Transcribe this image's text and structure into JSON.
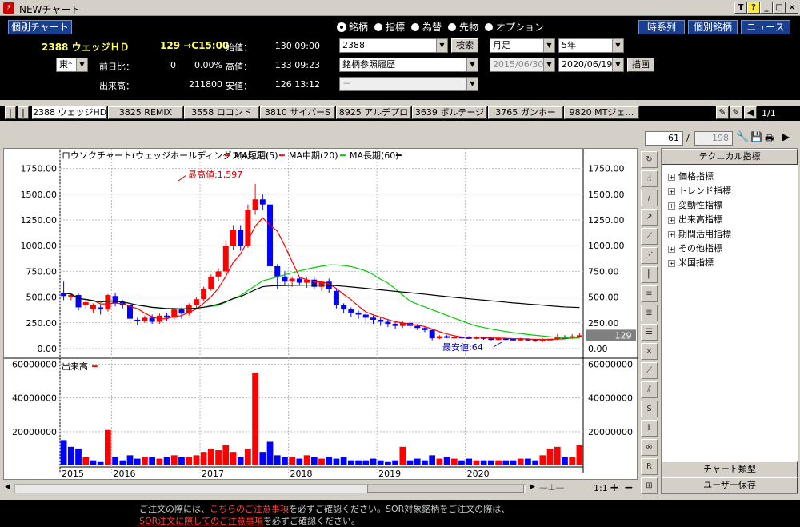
{
  "window": {
    "title": "NEWチャート",
    "controls": [
      "T",
      "?",
      "_",
      "□",
      "×"
    ]
  },
  "top": {
    "stock_list_btn": "個別チャート",
    "stock_code_name": "2388 ウェッジＨＤ",
    "price_line": "129 →C15:00",
    "exchange": "東*",
    "labels": {
      "open": "始値：",
      "high": "高値：",
      "low": "安値：",
      "change": "前日比：",
      "volume": "出来高："
    },
    "values": {
      "open": "130 09:00",
      "high": "133 09:23",
      "low": "126 13:12",
      "change": "0",
      "change_pct": "0.00%",
      "volume": "211800"
    },
    "radios": [
      {
        "label": "銘柄",
        "selected": true
      },
      {
        "label": "指標",
        "selected": false
      },
      {
        "label": "為替",
        "selected": false
      },
      {
        "label": "先物",
        "selected": false
      },
      {
        "label": "オプション",
        "selected": false
      }
    ],
    "code_input": "2388",
    "search_btn": "検索",
    "history_select": "銘柄参照履歴",
    "empty_select": "－",
    "period_select": "月足",
    "range_select": "5年",
    "date_from": "2015/06/30",
    "date_to": "2020/06/19",
    "draw_btn": "描画",
    "buttons_right": [
      "時系列",
      "個別銘柄",
      "ニュース"
    ]
  },
  "stock_tabs": [
    "2388 ウェッジHD",
    "3825 REMIX",
    "3558 ロコンド",
    "3810 サイバーS",
    "8925 アルデプロ",
    "3639 ボルテージ",
    "3765 ガンホー",
    "9820 MTジェ…"
  ],
  "page_counter": "1/1",
  "nav": {
    "current": "61",
    "sep": "/",
    "total": "198"
  },
  "chart": {
    "legend": "ロウソクチャート(ウェッジホールディングス)(月足)",
    "ma": [
      "MA短期(5)",
      "MA中期(20)",
      "MA長期(60)"
    ],
    "high_label": "最高値:1,597",
    "low_label": "最安値:64",
    "current_price": "129",
    "volume_label": "出来高"
  },
  "chart_data": {
    "type": "candlestick",
    "y_ticks": [
      "1750.00",
      "1500.00",
      "1250.00",
      "1000.00",
      "750.00",
      "500.00",
      "250.00",
      "0.00"
    ],
    "vol_ticks": [
      "60000000",
      "40000000",
      "20000000"
    ],
    "x_labels": [
      "2015",
      "2016",
      "2017",
      "2018",
      "2019",
      "2020"
    ],
    "ylim": [
      0,
      1750
    ],
    "volume_ylim": [
      0,
      60000000
    ],
    "candles": [
      [
        510,
        540,
        510,
        650,
        470,
        "d"
      ],
      [
        500,
        520,
        480,
        530,
        470,
        "u"
      ],
      [
        520,
        400,
        380,
        540,
        370,
        "d"
      ],
      [
        420,
        450,
        400,
        470,
        390,
        "u"
      ],
      [
        380,
        420,
        360,
        440,
        350,
        "u"
      ],
      [
        400,
        380,
        340,
        420,
        330,
        "d"
      ],
      [
        380,
        520,
        370,
        530,
        360,
        "u"
      ],
      [
        510,
        440,
        430,
        540,
        410,
        "d"
      ],
      [
        450,
        420,
        400,
        470,
        390,
        "d"
      ],
      [
        420,
        290,
        280,
        430,
        270,
        "d"
      ],
      [
        280,
        270,
        250,
        300,
        230,
        "d"
      ],
      [
        270,
        300,
        260,
        320,
        250,
        "u"
      ],
      [
        300,
        260,
        250,
        330,
        240,
        "d"
      ],
      [
        260,
        320,
        250,
        340,
        240,
        "u"
      ],
      [
        320,
        300,
        280,
        350,
        270,
        "d"
      ],
      [
        300,
        380,
        290,
        390,
        280,
        "u"
      ],
      [
        380,
        340,
        300,
        400,
        290,
        "d"
      ],
      [
        340,
        420,
        330,
        440,
        320,
        "u"
      ],
      [
        420,
        480,
        410,
        500,
        390,
        "u"
      ],
      [
        480,
        580,
        470,
        600,
        460,
        "u"
      ],
      [
        580,
        700,
        570,
        720,
        560,
        "u"
      ],
      [
        700,
        750,
        680,
        780,
        660,
        "u"
      ],
      [
        750,
        1000,
        740,
        1050,
        730,
        "u"
      ],
      [
        1000,
        1150,
        980,
        1200,
        960,
        "u"
      ],
      [
        1150,
        1000,
        980,
        1200,
        950,
        "d"
      ],
      [
        1000,
        1350,
        990,
        1400,
        980,
        "u"
      ],
      [
        1350,
        1450,
        1320,
        1600,
        1300,
        "u"
      ],
      [
        1450,
        1400,
        1380,
        1500,
        1350,
        "d"
      ],
      [
        1400,
        800,
        780,
        1420,
        760,
        "d"
      ],
      [
        800,
        700,
        600,
        820,
        580,
        "d"
      ],
      [
        700,
        650,
        620,
        750,
        610,
        "d"
      ],
      [
        650,
        680,
        620,
        700,
        600,
        "u"
      ],
      [
        680,
        640,
        620,
        690,
        610,
        "d"
      ],
      [
        640,
        670,
        600,
        690,
        590,
        "u"
      ],
      [
        670,
        600,
        590,
        700,
        580,
        "d"
      ],
      [
        600,
        650,
        570,
        660,
        560,
        "u"
      ],
      [
        650,
        580,
        560,
        680,
        540,
        "d"
      ],
      [
        560,
        420,
        400,
        580,
        390,
        "d"
      ],
      [
        420,
        380,
        350,
        440,
        340,
        "d"
      ],
      [
        380,
        350,
        320,
        400,
        310,
        "d"
      ],
      [
        350,
        330,
        300,
        370,
        290,
        "d"
      ],
      [
        330,
        300,
        280,
        350,
        260,
        "d"
      ],
      [
        300,
        280,
        250,
        320,
        240,
        "d"
      ],
      [
        280,
        260,
        230,
        300,
        220,
        "d"
      ],
      [
        260,
        240,
        220,
        280,
        210,
        "d"
      ],
      [
        240,
        220,
        200,
        260,
        190,
        "d"
      ],
      [
        220,
        250,
        210,
        270,
        200,
        "u"
      ],
      [
        250,
        220,
        210,
        270,
        200,
        "d"
      ],
      [
        220,
        200,
        190,
        240,
        180,
        "d"
      ],
      [
        200,
        180,
        170,
        210,
        160,
        "d"
      ],
      [
        180,
        100,
        90,
        190,
        80,
        "d"
      ],
      [
        100,
        120,
        95,
        130,
        90,
        "u"
      ],
      [
        120,
        110,
        100,
        130,
        100,
        "d"
      ],
      [
        110,
        115,
        100,
        125,
        100,
        "u"
      ],
      [
        115,
        110,
        100,
        120,
        100,
        "d"
      ],
      [
        110,
        105,
        95,
        120,
        95,
        "d"
      ],
      [
        105,
        110,
        95,
        120,
        90,
        "u"
      ],
      [
        110,
        100,
        90,
        115,
        85,
        "d"
      ],
      [
        100,
        95,
        85,
        110,
        80,
        "d"
      ],
      [
        95,
        100,
        85,
        110,
        80,
        "u"
      ],
      [
        100,
        95,
        85,
        105,
        80,
        "d"
      ],
      [
        95,
        90,
        80,
        100,
        75,
        "d"
      ],
      [
        90,
        95,
        80,
        105,
        75,
        "u"
      ],
      [
        95,
        85,
        75,
        100,
        70,
        "d"
      ],
      [
        85,
        80,
        70,
        95,
        65,
        "d"
      ],
      [
        80,
        90,
        70,
        100,
        64,
        "u"
      ],
      [
        90,
        95,
        80,
        110,
        75,
        "u"
      ],
      [
        95,
        110,
        90,
        140,
        85,
        "u"
      ],
      [
        110,
        100,
        95,
        130,
        90,
        "d"
      ],
      [
        100,
        120,
        95,
        140,
        90,
        "u"
      ],
      [
        120,
        129,
        110,
        150,
        105,
        "u"
      ]
    ],
    "volume": [
      [
        15,
        "d"
      ],
      [
        11,
        "d"
      ],
      [
        10,
        "d"
      ],
      [
        5,
        "u"
      ],
      [
        3,
        "d"
      ],
      [
        2,
        "d"
      ],
      [
        21,
        "u"
      ],
      [
        5,
        "d"
      ],
      [
        3,
        "d"
      ],
      [
        6,
        "d"
      ],
      [
        4,
        "d"
      ],
      [
        5,
        "u"
      ],
      [
        5,
        "d"
      ],
      [
        4,
        "u"
      ],
      [
        5,
        "d"
      ],
      [
        6,
        "u"
      ],
      [
        5,
        "d"
      ],
      [
        5,
        "u"
      ],
      [
        6,
        "u"
      ],
      [
        8,
        "u"
      ],
      [
        10,
        "u"
      ],
      [
        9,
        "u"
      ],
      [
        12,
        "u"
      ],
      [
        8,
        "u"
      ],
      [
        5,
        "d"
      ],
      [
        10,
        "u"
      ],
      [
        55,
        "u"
      ],
      [
        8,
        "d"
      ],
      [
        14,
        "d"
      ],
      [
        6,
        "d"
      ],
      [
        5,
        "d"
      ],
      [
        5,
        "u"
      ],
      [
        4,
        "d"
      ],
      [
        6,
        "u"
      ],
      [
        5,
        "d"
      ],
      [
        4,
        "u"
      ],
      [
        5,
        "d"
      ],
      [
        4,
        "d"
      ],
      [
        5,
        "d"
      ],
      [
        3,
        "d"
      ],
      [
        3,
        "d"
      ],
      [
        3,
        "d"
      ],
      [
        4,
        "d"
      ],
      [
        3,
        "d"
      ],
      [
        2,
        "d"
      ],
      [
        3,
        "d"
      ],
      [
        11,
        "u"
      ],
      [
        3,
        "d"
      ],
      [
        4,
        "d"
      ],
      [
        3,
        "d"
      ],
      [
        6,
        "d"
      ],
      [
        4,
        "u"
      ],
      [
        5,
        "d"
      ],
      [
        4,
        "u"
      ],
      [
        3,
        "d"
      ],
      [
        4,
        "d"
      ],
      [
        3,
        "u"
      ],
      [
        3,
        "d"
      ],
      [
        3,
        "d"
      ],
      [
        3,
        "u"
      ],
      [
        3,
        "d"
      ],
      [
        3,
        "d"
      ],
      [
        4,
        "u"
      ],
      [
        4,
        "d"
      ],
      [
        3,
        "d"
      ],
      [
        6,
        "u"
      ],
      [
        10,
        "u"
      ],
      [
        11,
        "u"
      ],
      [
        5,
        "d"
      ],
      [
        5,
        "u"
      ],
      [
        12,
        "u"
      ]
    ]
  },
  "right_panel": {
    "header": "テクニカル指標",
    "items": [
      "価格指標",
      "トレンド指標",
      "変動性指標",
      "出来高指標",
      "期間活用指標",
      "その他指標",
      "米国指標"
    ],
    "btn1": "チャート類型",
    "btn2": "ユーザー保存"
  },
  "bottom_bar": {
    "zoom": "1:1",
    "plus": "+",
    "minus": "−"
  },
  "footer": {
    "line1_a": "ご注文の際には、",
    "line1_link": "こちらのご注意事項",
    "line1_b": "を必ずご確認ください。SOR対象銘柄をご注文の際は、",
    "line2_link": "SOR注文に際してのご注意事項",
    "line2_b": "を必ずご確認ください。"
  }
}
